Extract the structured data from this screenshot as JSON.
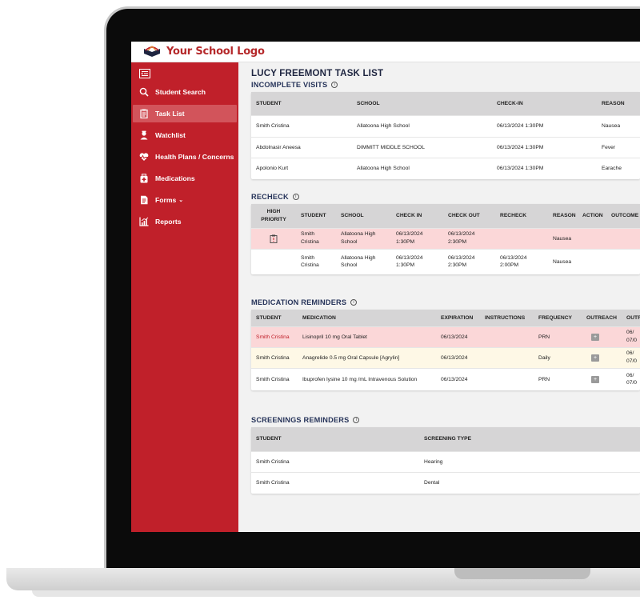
{
  "app": {
    "logo_text": "Your School Logo",
    "accent_color": "#c0202a"
  },
  "sidebar": {
    "items": [
      {
        "label": "Student Search",
        "icon": "search-icon"
      },
      {
        "label": "Task List",
        "icon": "clipboard-icon",
        "active": true
      },
      {
        "label": "Watchlist",
        "icon": "user-nurse-icon"
      },
      {
        "label": "Health Plans / Concerns",
        "icon": "heart-pulse-icon"
      },
      {
        "label": "Medications",
        "icon": "medicine-kit-icon"
      },
      {
        "label": "Forms",
        "icon": "file-form-icon",
        "has_dropdown": true
      },
      {
        "label": "Reports",
        "icon": "chart-icon"
      }
    ]
  },
  "page": {
    "title": "LUCY FREEMONT TASK LIST"
  },
  "incomplete_visits": {
    "title": "INCOMPLETE VISITS",
    "columns": [
      "STUDENT",
      "SCHOOL",
      "CHECK-IN",
      "REASON"
    ],
    "rows": [
      [
        "Smith Cristina",
        "Allatoona High School",
        "06/13/2024 1:30PM",
        "Nausea"
      ],
      [
        "Abdolnasir Aneesa",
        "DIMMITT MIDDLE SCHOOL",
        "06/13/2024 1:30PM",
        "Fever"
      ],
      [
        "Apolonio Kurt",
        "Allatoona High School",
        "06/13/2024 1:30PM",
        "Earache"
      ]
    ]
  },
  "recheck": {
    "title": "RECHECK",
    "columns": [
      "HIGH PRIORITY",
      "STUDENT",
      "SCHOOL",
      "CHECK IN",
      "CHECK OUT",
      "RECHECK",
      "REASON",
      "ACTION",
      "OUTCOME"
    ],
    "rows": [
      {
        "high_priority": true,
        "student": "Smith Cristina",
        "school": "Allatoona High School",
        "check_in": "06/13/2024 1:30PM",
        "check_out": "06/13/2024 2:30PM",
        "recheck": "",
        "reason": "Nausea"
      },
      {
        "high_priority": false,
        "student": "Smith Cristina",
        "school": "Allatoona High School",
        "check_in": "06/13/2024 1:30PM",
        "check_out": "06/13/2024 2:30PM",
        "recheck": "06/13/2024 2:00PM",
        "reason": "Nausea"
      }
    ]
  },
  "medication_reminders": {
    "title": "MEDICATION REMINDERS",
    "columns": [
      "STUDENT",
      "MEDICATION",
      "EXPIRATION",
      "INSTRUCTIONS",
      "FREQUENCY",
      "OUTREACH",
      "OUTR"
    ],
    "rows": [
      {
        "student": "Smith Cristina",
        "medication": "Lisinopril 10 mg Oral Tablet",
        "expiration": "06/13/2024",
        "instructions": "",
        "frequency": "PRN",
        "outr": [
          "06/",
          "07/0"
        ]
      },
      {
        "student": "Smith Cristina",
        "medication": "Anagrelide 0.5 mg Oral Capsule [Agrylin]",
        "expiration": "06/13/2024",
        "instructions": "",
        "frequency": "Daily",
        "outr": [
          "06/",
          "07/0"
        ]
      },
      {
        "student": "Smith Cristina",
        "medication": "Ibuprofen lysine 10 mg /mL Intravenous Solution",
        "expiration": "06/13/2024",
        "instructions": "",
        "frequency": "PRN",
        "outr": [
          "06/",
          "07/0"
        ]
      }
    ]
  },
  "screenings_reminders": {
    "title": "SCREENINGS REMINDERS",
    "columns": [
      "STUDENT",
      "SCREENING TYPE"
    ],
    "rows": [
      [
        "Smith Cristina",
        "Hearing"
      ],
      [
        "Smith Cristina",
        "Dental"
      ]
    ]
  }
}
